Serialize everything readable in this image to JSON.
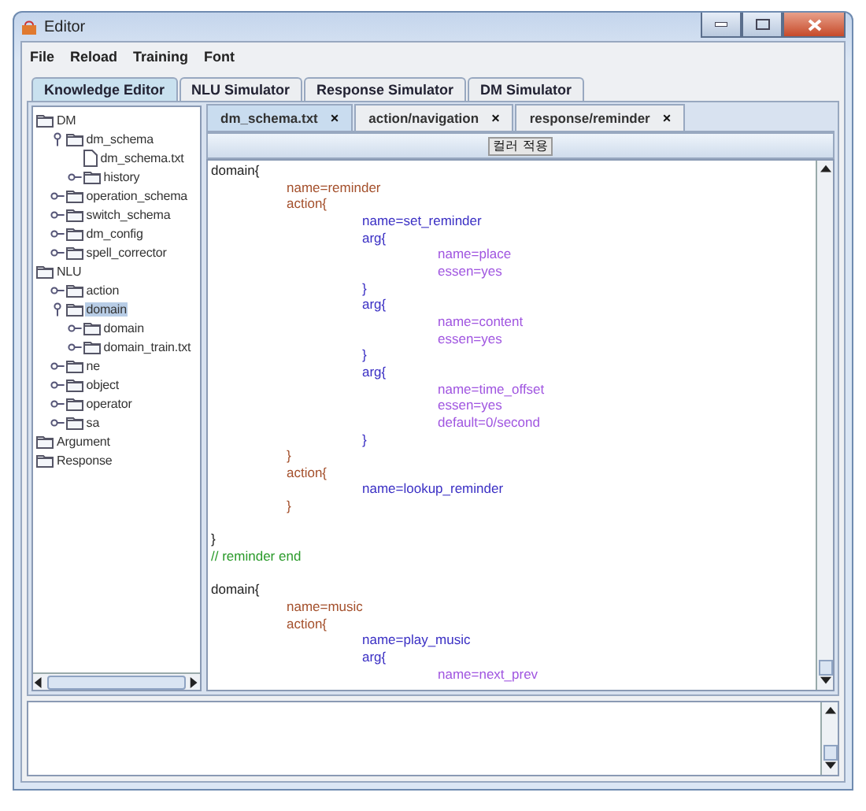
{
  "window": {
    "title": "Editor"
  },
  "menu": [
    "File",
    "Reload",
    "Training",
    "Font"
  ],
  "tabs": [
    {
      "label": "Knowledge Editor",
      "selected": true
    },
    {
      "label": "NLU Simulator",
      "selected": false
    },
    {
      "label": "Response Simulator",
      "selected": false
    },
    {
      "label": "DM Simulator",
      "selected": false
    }
  ],
  "tree": [
    {
      "label": "DM",
      "kind": "folder",
      "selected": false,
      "children": [
        {
          "label": "dm_schema",
          "kind": "folder",
          "expanded": true,
          "selected": false,
          "children": [
            {
              "label": "dm_schema.txt",
              "kind": "file",
              "selected": false
            },
            {
              "label": "history",
              "kind": "folder",
              "expanded": false,
              "selected": false
            }
          ]
        },
        {
          "label": "operation_schema",
          "kind": "folder",
          "expanded": false,
          "selected": false
        },
        {
          "label": "switch_schema",
          "kind": "folder",
          "expanded": false,
          "selected": false
        },
        {
          "label": "dm_config",
          "kind": "folder",
          "expanded": false,
          "selected": false
        },
        {
          "label": "spell_corrector",
          "kind": "folder",
          "expanded": false,
          "selected": false
        }
      ]
    },
    {
      "label": "NLU",
      "kind": "folder",
      "selected": false,
      "children": [
        {
          "label": "action",
          "kind": "folder",
          "expanded": false,
          "selected": false
        },
        {
          "label": "domain",
          "kind": "folder",
          "expanded": true,
          "selected": true,
          "children": [
            {
              "label": "domain",
              "kind": "folder",
              "expanded": false,
              "selected": false
            },
            {
              "label": "domain_train.txt",
              "kind": "folder",
              "expanded": false,
              "selected": false
            }
          ]
        },
        {
          "label": "ne",
          "kind": "folder",
          "expanded": false,
          "selected": false
        },
        {
          "label": "object",
          "kind": "folder",
          "expanded": false,
          "selected": false
        },
        {
          "label": "operator",
          "kind": "folder",
          "expanded": false,
          "selected": false
        },
        {
          "label": "sa",
          "kind": "folder",
          "expanded": false,
          "selected": false
        }
      ]
    },
    {
      "label": "Argument",
      "kind": "folder",
      "selected": false
    },
    {
      "label": "Response",
      "kind": "folder",
      "selected": false
    }
  ],
  "editor_tabs": [
    {
      "label": "dm_schema.txt",
      "close": "×",
      "selected": true
    },
    {
      "label": "action/navigation",
      "close": "×",
      "selected": false
    },
    {
      "label": "response/reminder",
      "close": "×",
      "selected": false
    }
  ],
  "color_button": "컬러 적용",
  "code": [
    {
      "kind": "code",
      "text": "domain{",
      "children": [
        {
          "kind": "code",
          "text": "name=reminder"
        },
        {
          "kind": "code",
          "text": "action{",
          "children": [
            {
              "kind": "code",
              "text": "name=set_reminder"
            },
            {
              "kind": "code",
              "text": "arg{",
              "children": [
                {
                  "kind": "code",
                  "text": "name=place"
                },
                {
                  "kind": "code",
                  "text": "essen=yes"
                }
              ]
            },
            {
              "kind": "code",
              "text": "}"
            },
            {
              "kind": "code",
              "text": "arg{",
              "children": [
                {
                  "kind": "code",
                  "text": "name=content"
                },
                {
                  "kind": "code",
                  "text": "essen=yes"
                }
              ]
            },
            {
              "kind": "code",
              "text": "}"
            },
            {
              "kind": "code",
              "text": "arg{",
              "children": [
                {
                  "kind": "code",
                  "text": "name=time_offset"
                },
                {
                  "kind": "code",
                  "text": "essen=yes"
                },
                {
                  "kind": "code",
                  "text": "default=0/second"
                }
              ]
            },
            {
              "kind": "code",
              "text": "}"
            }
          ]
        },
        {
          "kind": "code",
          "text": "}"
        },
        {
          "kind": "code",
          "text": "action{",
          "children": [
            {
              "kind": "code",
              "text": "name=lookup_reminder"
            }
          ]
        },
        {
          "kind": "code",
          "text": "}"
        },
        {
          "kind": "blank"
        }
      ]
    },
    {
      "kind": "code",
      "text": "}"
    },
    {
      "kind": "comment",
      "text": "// reminder end"
    },
    {
      "kind": "blank"
    },
    {
      "kind": "code",
      "text": "domain{",
      "children": [
        {
          "kind": "code",
          "text": "name=music"
        },
        {
          "kind": "code",
          "text": "action{",
          "children": [
            {
              "kind": "code",
              "text": "name=play_music"
            },
            {
              "kind": "code",
              "text": "arg{",
              "children": [
                {
                  "kind": "code",
                  "text": "name=next_prev"
                }
              ]
            }
          ]
        }
      ]
    }
  ]
}
